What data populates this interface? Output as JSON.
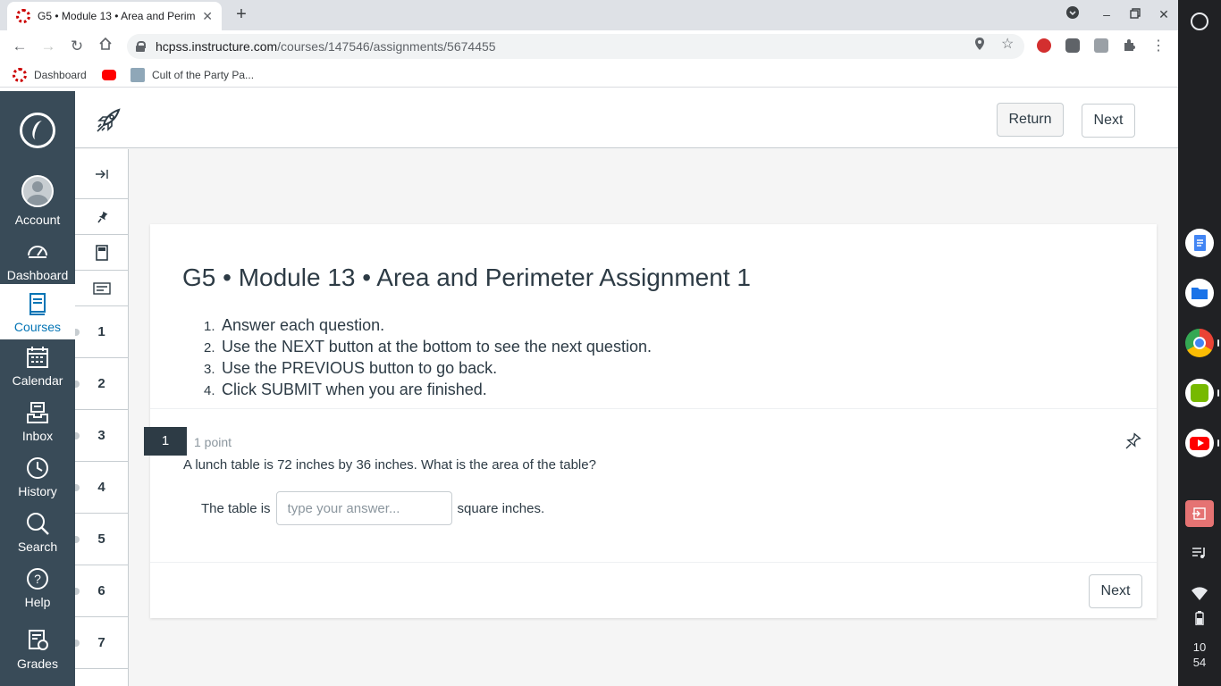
{
  "browser": {
    "tab_title": "G5 • Module 13 • Area and Perim",
    "url_host": "hcpss.instructure.com",
    "url_path": "/courses/147546/assignments/5674455",
    "bookmarks": [
      {
        "label": "Dashboard"
      },
      {
        "label": ""
      },
      {
        "label": "Cult of the Party Pa..."
      }
    ]
  },
  "global_nav": {
    "items": [
      {
        "label": "Account"
      },
      {
        "label": "Dashboard"
      },
      {
        "label": "Courses"
      },
      {
        "label": "Calendar"
      },
      {
        "label": "Inbox"
      },
      {
        "label": "History"
      },
      {
        "label": "Search"
      },
      {
        "label": "Help"
      },
      {
        "label": "Grades"
      }
    ],
    "active_color": "#0374b5",
    "bg_color": "#394b58"
  },
  "header": {
    "return_label": "Return",
    "next_label": "Next"
  },
  "question_nav": {
    "numbers": [
      "1",
      "2",
      "3",
      "4",
      "5",
      "6",
      "7"
    ]
  },
  "quiz": {
    "title": "G5 • Module 13 • Area and Perimeter Assignment 1",
    "instructions": [
      {
        "num": "1.",
        "text": "Answer each question."
      },
      {
        "num": "2.",
        "text": "Use the NEXT button at the bottom to see the next question."
      },
      {
        "num": "3.",
        "text": "Use the PREVIOUS button to go back."
      },
      {
        "num": "4.",
        "text": "Click SUBMIT when you are finished."
      }
    ],
    "question": {
      "number": "1",
      "points": "1 point",
      "text": "A lunch table is 72 inches by 36 inches. What is the area of the table?",
      "prefix": "The table is",
      "placeholder": "type your answer...",
      "value": "",
      "suffix": "square inches."
    },
    "next_label": "Next"
  },
  "shelf": {
    "time_hour": "10",
    "time_min": "54"
  }
}
